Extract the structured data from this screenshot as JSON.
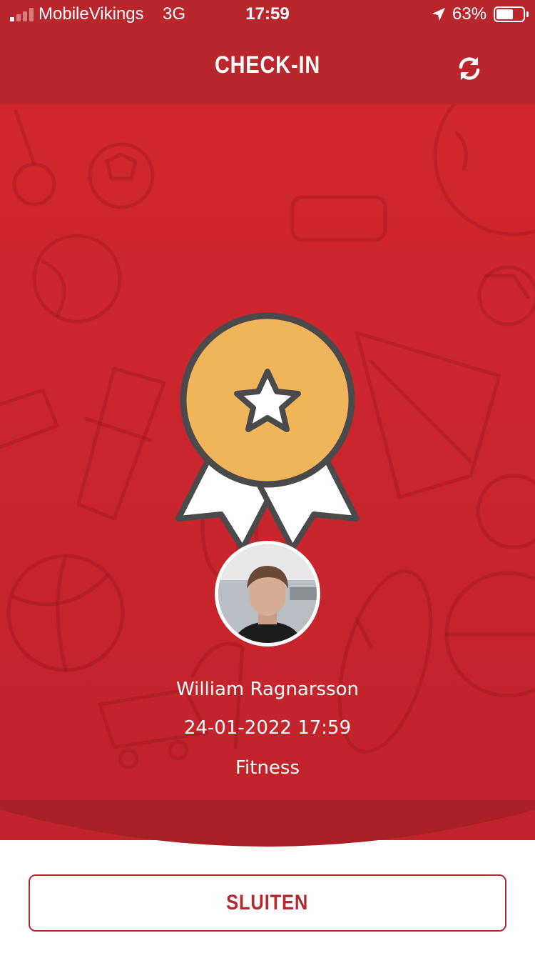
{
  "status_bar": {
    "carrier": "MobileVikings",
    "network": "3G",
    "time": "17:59",
    "battery_percent": "63%",
    "battery_level": 0.63,
    "signal_bars": 1
  },
  "header": {
    "title": "CHECK-IN",
    "refresh_icon": "refresh-icon"
  },
  "badge": {
    "icon": "medal-star-icon",
    "colors": {
      "medal": "#f0b45a",
      "outline": "#4a4a4c",
      "ribbon": "#ffffff"
    }
  },
  "checkin": {
    "name": "William Ragnarsson",
    "datetime": "24-01-2022 17:59",
    "activity": "Fitness"
  },
  "footer": {
    "close_label": "SLUITEN"
  },
  "colors": {
    "brand_red": "#b9272c",
    "panel_red": "#cd2630",
    "white": "#ffffff"
  }
}
